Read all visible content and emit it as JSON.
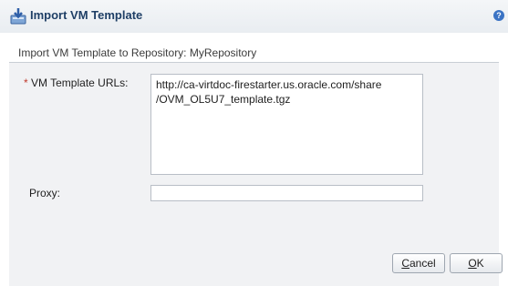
{
  "dialog": {
    "title": "Import VM Template",
    "help_icon": "help-icon",
    "title_icon": "import-template-icon",
    "subtitle": "Import VM Template to Repository: MyRepository"
  },
  "form": {
    "urls_required_marker": "*",
    "urls_label": "VM Template URLs:",
    "urls_value_line1": "http://ca-virtdoc-firestarter.us.oracle.com/share",
    "urls_value_line2": "/OVM_OL5U7_template.tgz",
    "proxy_label": "Proxy:",
    "proxy_value": ""
  },
  "buttons": {
    "cancel_accel": "C",
    "cancel_rest": "ancel",
    "ok_accel": "O",
    "ok_rest": "K"
  },
  "colors": {
    "title_text": "#1f3f66",
    "panel_bg": "#f1f2f4",
    "required_marker": "#c0392b",
    "help_icon_bg": "#3b73c4"
  }
}
